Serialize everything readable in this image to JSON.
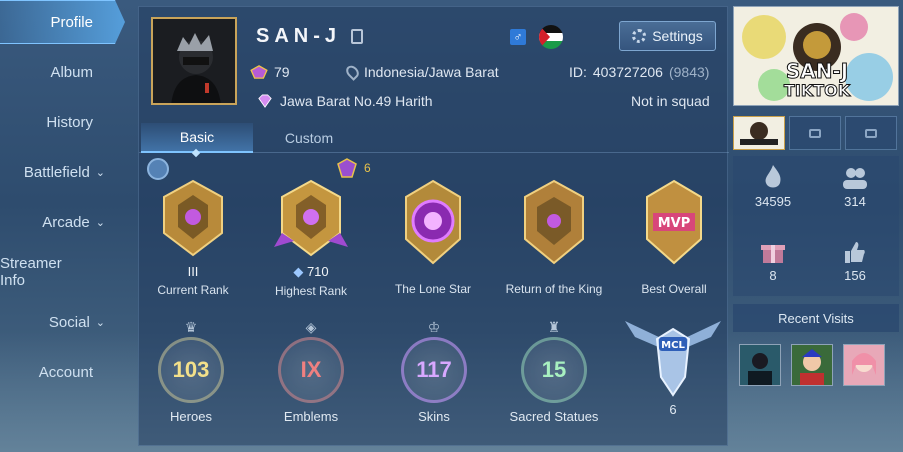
{
  "sidebar": {
    "items": [
      {
        "label": "Profile",
        "chevron": false
      },
      {
        "label": "Album",
        "chevron": false
      },
      {
        "label": "History",
        "chevron": false
      },
      {
        "label": "Battlefield",
        "chevron": true
      },
      {
        "label": "Arcade",
        "chevron": true
      },
      {
        "label": "Streamer Info",
        "chevron": false
      },
      {
        "label": "Social",
        "chevron": true
      },
      {
        "label": "Account",
        "chevron": false
      }
    ],
    "active": "Profile"
  },
  "profile": {
    "name": "SAN-J",
    "level": "79",
    "location": "Indonesia/Jawa Barat",
    "id_label": "ID:",
    "id": "403727206",
    "server": "(9843)",
    "title": "Jawa Barat No.49 Harith",
    "squad": "Not in squad",
    "settings_label": "Settings",
    "gender_symbol": "♂"
  },
  "tabs": [
    {
      "label": "Basic",
      "active": true
    },
    {
      "label": "Custom",
      "active": false
    }
  ],
  "star_count": "6",
  "achievements": [
    {
      "label": "Current Rank",
      "sub": "III",
      "color": "#c9a04a"
    },
    {
      "label": "Highest Rank",
      "sub": "710",
      "color": "#c9a04a"
    },
    {
      "label": "The Lone Star",
      "sub": "",
      "color": "#b43ad0"
    },
    {
      "label": "Return of the King",
      "sub": "",
      "color": "#c9a04a"
    },
    {
      "label": "Best Overall",
      "sub": "",
      "color": "#c9a04a"
    }
  ],
  "stats": [
    {
      "label": "Heroes",
      "value": "103",
      "color": "#f3e08a"
    },
    {
      "label": "Emblems",
      "value": "IX",
      "color": "#f08080"
    },
    {
      "label": "Skins",
      "value": "117",
      "color": "#d8a8ff"
    },
    {
      "label": "Sacred Statues",
      "value": "15",
      "color": "#a8f0c0"
    },
    {
      "label": "",
      "value": "6",
      "color": "#ffffff"
    }
  ],
  "right": {
    "banner_line1": "SAN-J",
    "banner_line2": "TIKTOK",
    "popularity": "34595",
    "followers": "314",
    "gifts": "8",
    "likes": "156",
    "recent_visits": "Recent Visits"
  }
}
